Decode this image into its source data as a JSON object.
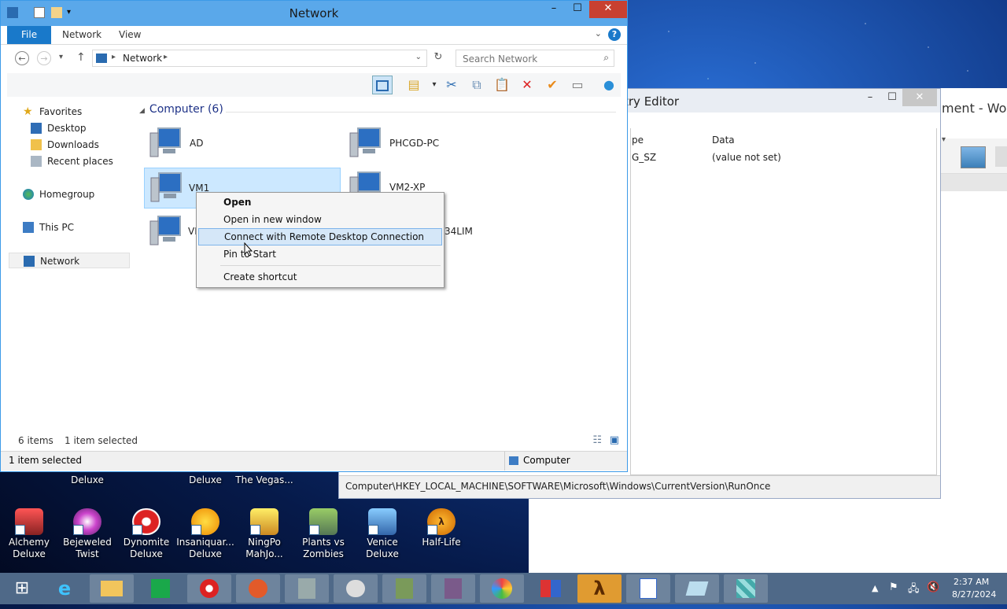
{
  "explorer": {
    "title": "Network",
    "tabs": [
      "File",
      "Network",
      "View"
    ],
    "address": "Network",
    "search_placeholder": "Search Network",
    "nav": {
      "favorites": "Favorites",
      "desktop": "Desktop",
      "downloads": "Downloads",
      "recent": "Recent places",
      "homegroup": "Homegroup",
      "thispc": "This PC",
      "network": "Network"
    },
    "group_header": "Computer (6)",
    "computers": [
      "AD",
      "PHCGD-PC",
      "VM1",
      "VM2-XP",
      "VI",
      "34LIM"
    ],
    "status_items": "6 items",
    "status_selected": "1 item selected",
    "details_selected": "1 item selected",
    "details_type": "Computer"
  },
  "context_menu": {
    "open": "Open",
    "open_new": "Open in new window",
    "rdp": "Connect with Remote Desktop Connection",
    "pin": "Pin to Start",
    "shortcut": "Create shortcut"
  },
  "registry": {
    "title_partial": "try Editor",
    "col_type": "pe",
    "col_data": "Data",
    "row_type": "G_SZ",
    "row_data": "(value not set)",
    "status_path": "Computer\\HKEY_LOCAL_MACHINE\\SOFTWARE\\Microsoft\\Windows\\CurrentVersion\\RunOnce"
  },
  "word": {
    "title_partial": "ment - Word"
  },
  "desktop_top_labels": [
    "Deluxe",
    "Deluxe",
    "The Vegas..."
  ],
  "desktop_icons": [
    {
      "l1": "Alchemy",
      "l2": "Deluxe"
    },
    {
      "l1": "Bejeweled",
      "l2": "Twist"
    },
    {
      "l1": "Dynomite",
      "l2": "Deluxe"
    },
    {
      "l1": "Insaniquar...",
      "l2": "Deluxe"
    },
    {
      "l1": "NingPo",
      "l2": "MahJo..."
    },
    {
      "l1": "Plants vs",
      "l2": "Zombies"
    },
    {
      "l1": "Venice",
      "l2": "Deluxe"
    },
    {
      "l1": "Half-Life",
      "l2": ""
    }
  ],
  "tray": {
    "time": "2:37 AM",
    "date": "8/27/2024"
  }
}
